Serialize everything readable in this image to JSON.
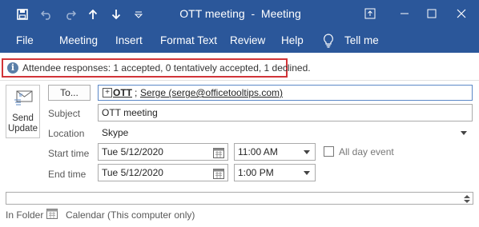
{
  "window": {
    "title": "OTT meeting  -  Meeting"
  },
  "ribbon": {
    "tabs": [
      "File",
      "Meeting",
      "Insert",
      "Format Text",
      "Review",
      "Help"
    ],
    "tell_me": "Tell me"
  },
  "infobar": {
    "text": "Attendee responses: 1 accepted, 0 tentatively accepted, 1 declined."
  },
  "send_button": {
    "line1": "Send",
    "line2": "Update"
  },
  "to": {
    "button_label": "To...",
    "recipient_1": "OTT",
    "separator": ";",
    "recipient_2": "Serge (serge@officetooltips.com)"
  },
  "subject": {
    "label": "Subject",
    "value": "OTT meeting"
  },
  "location": {
    "label": "Location",
    "value": "Skype"
  },
  "start": {
    "label": "Start time",
    "date": "Tue 5/12/2020",
    "time": "11:00 AM"
  },
  "end": {
    "label": "End time",
    "date": "Tue 5/12/2020",
    "time": "1:00 PM"
  },
  "all_day": {
    "label": "All day event",
    "checked": false
  },
  "footer": {
    "label": "In Folder",
    "value": "Calendar (This computer only)"
  },
  "colors": {
    "accent": "#2b579a",
    "highlight_border": "#d13438",
    "info_icon": "#5b7fa8"
  }
}
